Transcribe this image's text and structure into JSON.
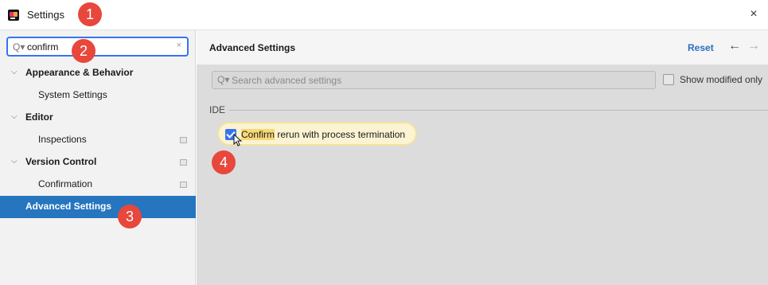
{
  "titlebar": {
    "title": "Settings",
    "close_glyph": "×"
  },
  "sidebar": {
    "search": {
      "value": "confirm",
      "search_icon_glyph": "Q▾",
      "clear_glyph": "×"
    },
    "items": [
      {
        "label": "Appearance & Behavior",
        "expanded": true,
        "bold": true,
        "level": 0,
        "modified": false
      },
      {
        "label": "System Settings",
        "level": 1,
        "modified": false
      },
      {
        "label": "Editor",
        "expanded": true,
        "bold": true,
        "level": 0,
        "modified": false
      },
      {
        "label": "Inspections",
        "level": 1,
        "modified": true
      },
      {
        "label": "Version Control",
        "expanded": true,
        "bold": true,
        "level": 0,
        "modified": true
      },
      {
        "label": "Confirmation",
        "level": 1,
        "modified": true
      },
      {
        "label": "Advanced Settings",
        "bold": true,
        "level": 0,
        "selected": true,
        "modified": false
      }
    ],
    "chevron_glyph": "⌵"
  },
  "main": {
    "title": "Advanced Settings",
    "reset_label": "Reset",
    "back_glyph": "←",
    "forward_glyph": "→",
    "search": {
      "placeholder": "Search advanced settings",
      "search_icon_glyph": "Q▾"
    },
    "show_modified_label": "Show modified only",
    "show_modified_checked": false,
    "section": "IDE",
    "option": {
      "highlight": "Confirm",
      "rest": " rerun with process termination",
      "checked": true
    }
  },
  "badges": [
    "1",
    "2",
    "3",
    "4"
  ],
  "colors": {
    "accent": "#3574f0",
    "selection": "#2675bf",
    "badge": "#e8473c",
    "highlight": "#f7d978",
    "link": "#2d6dbd"
  }
}
